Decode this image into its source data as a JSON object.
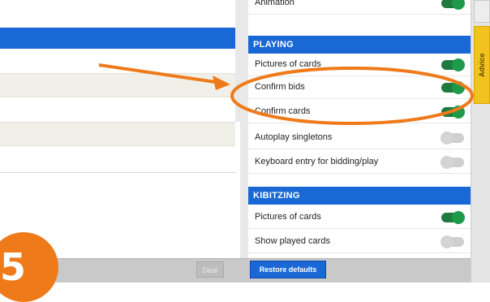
{
  "colors": {
    "accent_blue": "#1a68d6",
    "toggle_on": "#1f9a4b",
    "toggle_off": "#d4d4d4",
    "annotation_orange": "#ef7a1a",
    "tab_yellow": "#f2c320"
  },
  "settings": {
    "top_partial_label": "Animation",
    "sections": [
      {
        "title": "PLAYING",
        "items": [
          {
            "label": "Pictures of cards",
            "enabled": true
          },
          {
            "label": "Confirm bids",
            "enabled": true
          },
          {
            "label": "Confirm cards",
            "enabled": true
          },
          {
            "label": "Autoplay singletons",
            "enabled": false
          },
          {
            "label": "Keyboard entry for bidding/play",
            "enabled": false
          }
        ]
      },
      {
        "title": "KIBITZING",
        "items": [
          {
            "label": "Pictures of cards",
            "enabled": true
          },
          {
            "label": "Show played cards",
            "enabled": false
          }
        ]
      }
    ]
  },
  "side_tab": {
    "label": "Advice"
  },
  "bottom_bar": {
    "deal_label": "Deal",
    "restore_label": "Restore defaults"
  },
  "annotation": {
    "step_number": "5",
    "highlighted_item": "Confirm bids"
  }
}
